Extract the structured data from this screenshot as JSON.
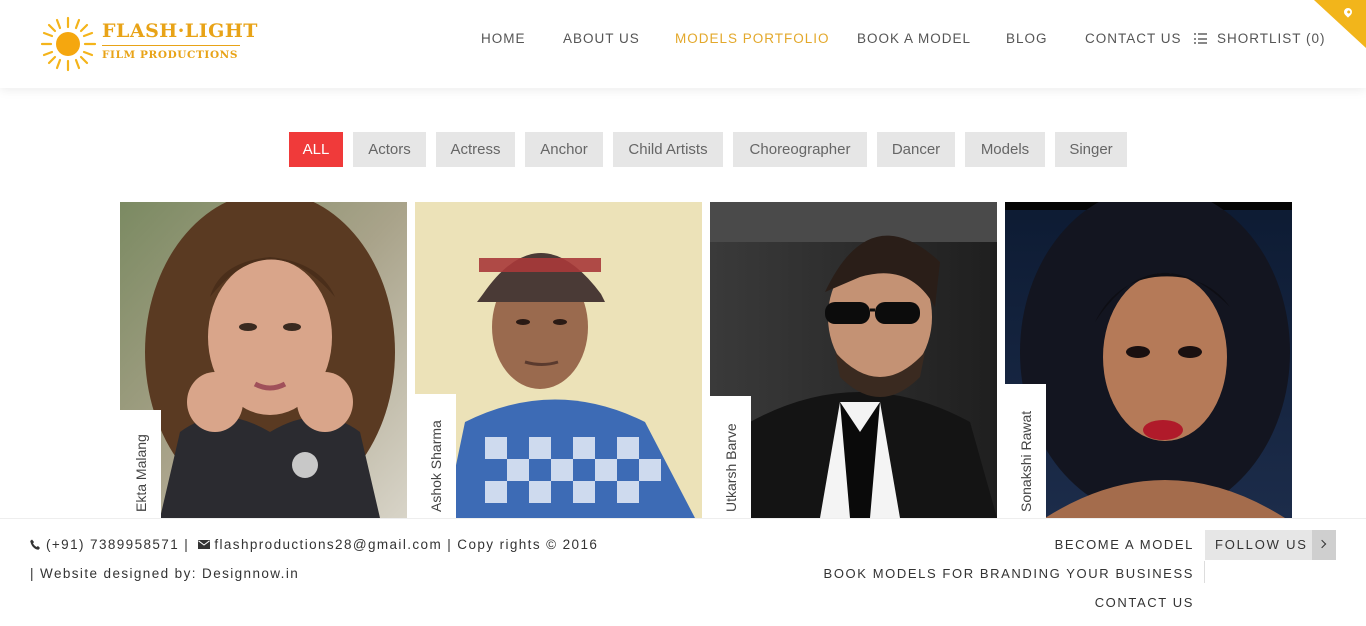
{
  "brand": {
    "title": "FLASH·LIGHT",
    "subtitle": "FILM PRODUCTIONS",
    "color": "#e8a317"
  },
  "nav": {
    "items": [
      {
        "label": "HOME"
      },
      {
        "label": "ABOUT US"
      },
      {
        "label": "MODELS PORTFOLIO"
      },
      {
        "label": "BOOK A MODEL"
      },
      {
        "label": "BLOG"
      },
      {
        "label": "CONTACT US"
      },
      {
        "label": "SHORTLIST (0)"
      }
    ],
    "active_index": 2,
    "active_color": "#e3a82b"
  },
  "corner_icon": "map-marker-icon",
  "filters": {
    "items": [
      "ALL",
      "Actors",
      "Actress",
      "Anchor",
      "Child Artists",
      "Choreographer",
      "Dancer",
      "Models",
      "Singer"
    ],
    "active": "ALL",
    "active_color": "#f03a3a"
  },
  "models": [
    {
      "name": "Ekta Malang"
    },
    {
      "name": "Ashok Sharma"
    },
    {
      "name": "Utkarsh Barve"
    },
    {
      "name": "Sonakshi Rawat"
    }
  ],
  "footer": {
    "phone": "(+91) 7389958571",
    "sep1": " | ",
    "email": "flashproductions28@gmail.com",
    "copyright": " | Copy rights © 2016",
    "designed_by": "| Website designed by: Designnow.in",
    "links": [
      "BECOME A MODEL",
      "BOOK MODELS FOR BRANDING YOUR BUSINESS",
      "CONTACT US"
    ],
    "follow_label": "FOLLOW US"
  }
}
